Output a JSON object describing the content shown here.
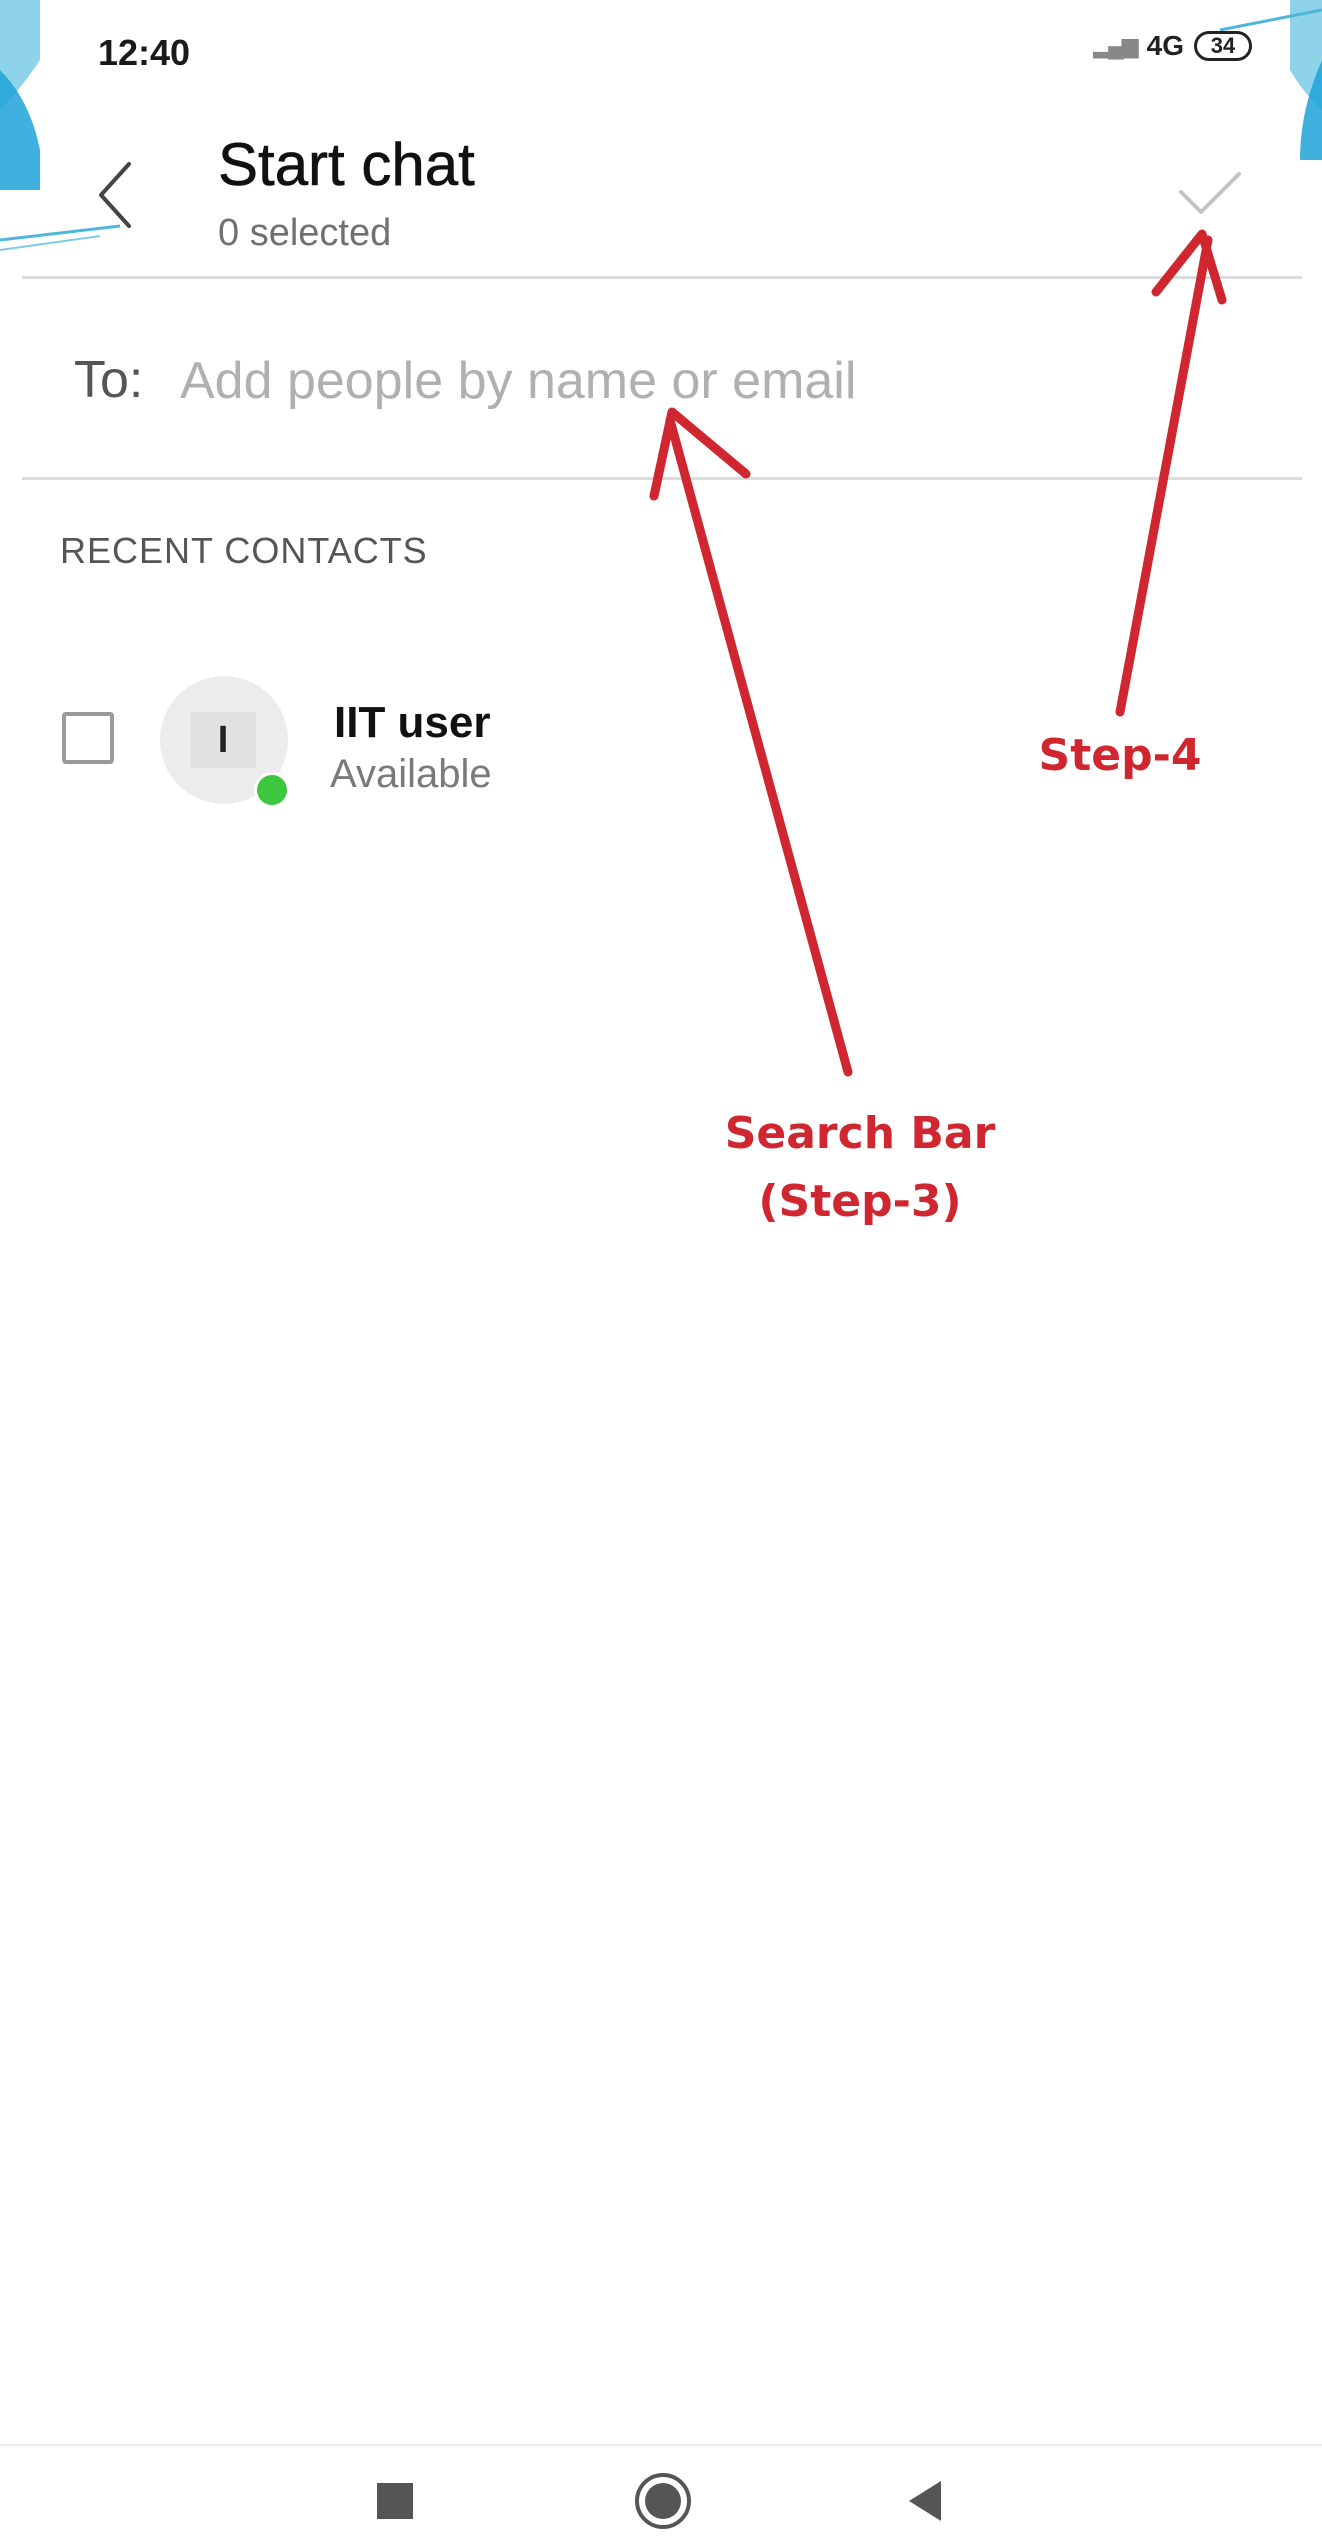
{
  "status_bar": {
    "time": "12:40",
    "signal_icon": "signal-icon",
    "network": "4G",
    "battery": "34"
  },
  "header": {
    "back_icon": "chevron-left-icon",
    "title": "Start chat",
    "subtitle": "0 selected",
    "confirm_icon": "check-icon"
  },
  "recipients": {
    "label": "To:",
    "placeholder": "Add people by name or email",
    "value": ""
  },
  "recent_contacts": {
    "section_title": "RECENT CONTACTS",
    "items": [
      {
        "initial": "I",
        "name": "IIT user",
        "status": "Available",
        "selected": false,
        "presence_color": "#3fc63f"
      }
    ]
  },
  "annotations": {
    "color": "#d0262f",
    "step4": "Step-4",
    "search_bar_line1": "Search Bar",
    "search_bar_line2": "(Step-3)"
  },
  "nav_bar": {
    "recent_icon": "square-icon",
    "home_icon": "circle-icon",
    "back_icon": "triangle-back-icon"
  }
}
